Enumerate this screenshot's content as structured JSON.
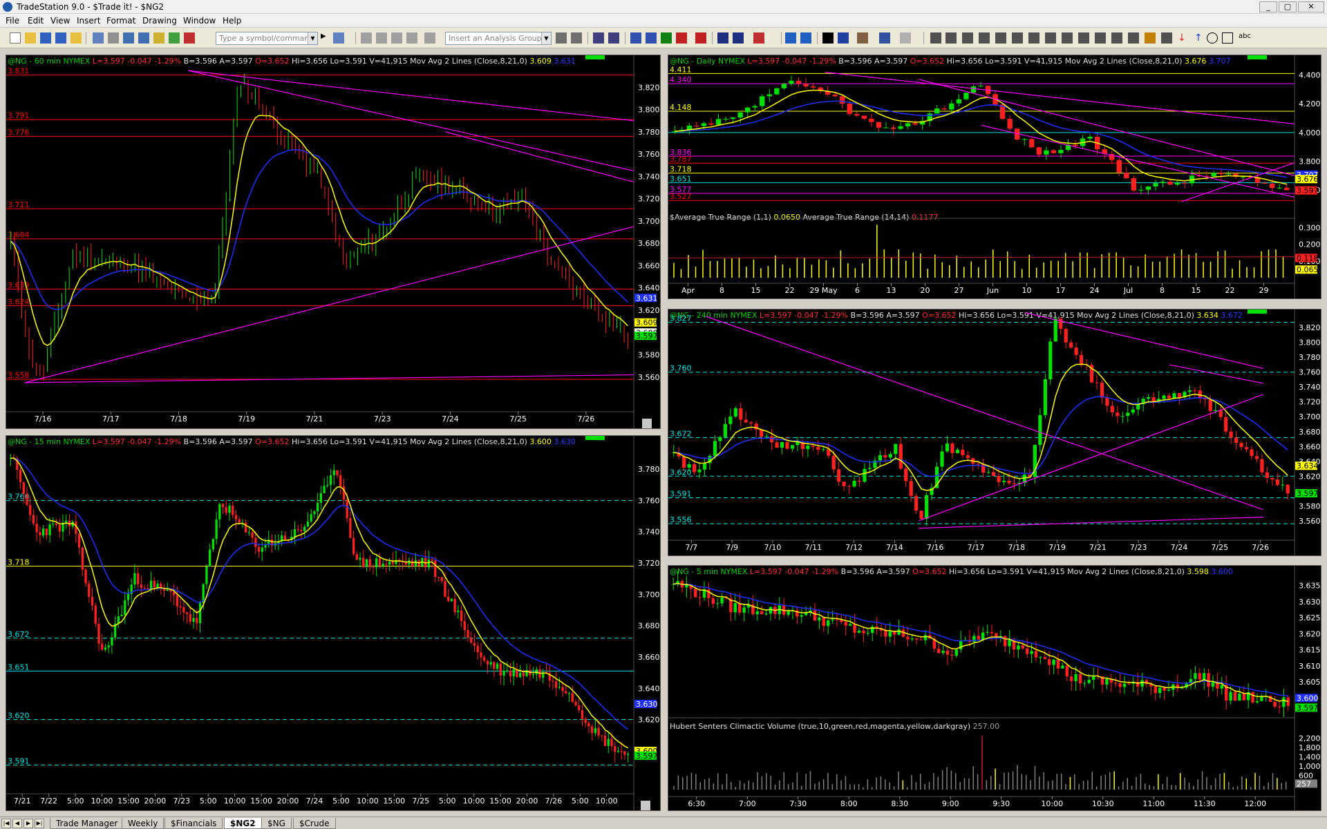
{
  "window": {
    "title": "TradeStation 9.0 - $Trade it! - $NG2"
  },
  "menu": [
    "File",
    "Edit",
    "View",
    "Insert",
    "Format",
    "Drawing",
    "Window",
    "Help"
  ],
  "toolbar": {
    "symbol_placeholder": "Type a symbol/command",
    "analysis_placeholder": "Insert an Analysis Group"
  },
  "colors": {
    "background": "#000000",
    "up_bar": "#00e000",
    "down_bar": "#ff2020",
    "avg_fast": "#ffff00",
    "avg_slow": "#2030ff",
    "trendline": "#ff00ff",
    "hline_red": "#ff0000",
    "hline_cyan": "#00e5e5",
    "hline_yellow": "#ffff00",
    "axis_text": "#ffffff"
  },
  "charts": {
    "c60": {
      "symbol": "@NG - 60 min NYMEX",
      "quote": {
        "L": "L=3.597",
        "chg": "-0.047",
        "pct": "-1.29%",
        "B": "B=3.596",
        "A": "A=3.597",
        "O": "O=3.652",
        "H": "Hi=3.656",
        "Lo": "Lo=3.591",
        "V": "V=41,915",
        "study": "Mov Avg 2 Lines (Close,8,21,0)",
        "v1": "3.609",
        "v2": "3.631"
      },
      "y_ticks": [
        "3.820",
        "3.800",
        "3.780",
        "3.760",
        "3.740",
        "3.720",
        "3.700",
        "3.680",
        "3.660",
        "3.640",
        "3.620",
        "3.580",
        "3.560"
      ],
      "x_ticks": [
        "7/16",
        "7/17",
        "7/18",
        "7/19",
        "7/21",
        "7/23",
        "7/24",
        "7/25",
        "7/26"
      ],
      "hlines": [
        "3.831",
        "3.791",
        "3.776",
        "3.711",
        "3.684",
        "3.639",
        "3.624",
        "3.558"
      ],
      "tags": [
        "3.631",
        "3.609",
        "3.600",
        "3.597"
      ]
    },
    "c15": {
      "symbol": "@NG - 15 min NYMEX",
      "quote": {
        "L": "L=3.597",
        "chg": "-0.047",
        "pct": "-1.29%",
        "B": "B=3.596",
        "A": "A=3.597",
        "O": "O=3.652",
        "H": "Hi=3.656",
        "Lo": "Lo=3.591",
        "V": "V=41,915",
        "study": "Mov Avg 2 Lines (Close,8,21,0)",
        "v1": "3.600",
        "v2": "3.630"
      },
      "y_ticks": [
        "3.780",
        "3.760",
        "3.740",
        "3.720",
        "3.700",
        "3.680",
        "3.660",
        "3.640",
        "3.620"
      ],
      "x_ticks": [
        "7/21",
        "7/22",
        "5:00",
        "10:00",
        "15:00",
        "20:00",
        "7/23",
        "5:00",
        "10:00",
        "15:00",
        "20:00",
        "7/24",
        "5:00",
        "10:00",
        "15:00",
        "7/25",
        "5:00",
        "10:00",
        "15:00",
        "20:00",
        "7/26",
        "5:00",
        "10:00"
      ],
      "hlines": [
        "3.760",
        "3.718",
        "3.672",
        "3.651",
        "3.620",
        "3.591"
      ],
      "tags": [
        "3.630",
        "3.600",
        "3.597"
      ]
    },
    "daily": {
      "symbol": "@NG - Daily NYMEX",
      "quote": {
        "L": "L=3.597",
        "chg": "-0.047",
        "pct": "-1.29%",
        "B": "B=3.596",
        "A": "A=3.597",
        "O": "O=3.652",
        "H": "Hi=3.656",
        "Lo": "Lo=3.591",
        "V": "V=41,915",
        "study": "Mov Avg 2 Lines (Close,8,21,0)",
        "v1": "3.676",
        "v2": "3.707"
      },
      "y_ticks": [
        "4.400",
        "4.200",
        "4.000",
        "3.800",
        "3.600"
      ],
      "hlines": [
        "4.411",
        "4.340",
        "4.148",
        "4.0",
        "3.836",
        "3.787",
        "3.718",
        "3.651",
        "3.577",
        "3.527"
      ],
      "tags": [
        "3.707",
        "3.676",
        "3.597"
      ],
      "atr_title": "$Average True Range (1,1)",
      "atr_v1": "0.0650",
      "atr2_title": "Average True Range (14,14)",
      "atr_v2": "0.1177",
      "atr_ticks": [
        "0.300",
        "0.200",
        "0.100"
      ],
      "atr_tags": [
        "0.118",
        "0.065"
      ],
      "x_ticks": [
        "Apr",
        "8",
        "15",
        "22",
        "29 May",
        "6",
        "13",
        "20",
        "27",
        "Jun",
        "10",
        "17",
        "24",
        "Jul",
        "8",
        "15",
        "22",
        "29"
      ]
    },
    "c240": {
      "symbol": "@NG - 240 min NYMEX",
      "quote": {
        "L": "L=3.597",
        "chg": "-0.047",
        "pct": "-1.29%",
        "B": "B=3.596",
        "A": "A=3.597",
        "O": "O=3.652",
        "H": "Hi=3.656",
        "Lo": "Lo=3.591",
        "V": "V=41,915",
        "study": "Mov Avg 2 Lines (Close,8,21,0)",
        "v1": "3.634",
        "v2": "3.672"
      },
      "y_ticks": [
        "3.820",
        "3.800",
        "3.780",
        "3.760",
        "3.740",
        "3.720",
        "3.700",
        "3.680",
        "3.660",
        "3.640",
        "3.620",
        "3.580",
        "3.560"
      ],
      "hlines": [
        "3.827",
        "3.760",
        "3.672",
        "3.620",
        "3.591",
        "3.556"
      ],
      "tags": [
        "3.634",
        "3.597"
      ],
      "x_ticks": [
        "7/7",
        "7/9",
        "7/10",
        "7/11",
        "7/12",
        "7/14",
        "7/16",
        "7/17",
        "7/18",
        "7/19",
        "7/21",
        "7/23",
        "7/24",
        "7/25",
        "7/26"
      ]
    },
    "c5": {
      "symbol": "@NG - 5 min NYMEX",
      "quote": {
        "L": "L=3.597",
        "chg": "-0.047",
        "pct": "-1.29%",
        "B": "B=3.596",
        "A": "A=3.597",
        "O": "O=3.652",
        "H": "Hi=3.656",
        "Lo": "Lo=3.591",
        "V": "V=41,915",
        "study": "Mov Avg 2 Lines (Close,8,21,0)",
        "v1": "3.598",
        "v2": "3.600"
      },
      "y_ticks": [
        "3.635",
        "3.630",
        "3.625",
        "3.620",
        "3.615",
        "3.610",
        "3.605"
      ],
      "tags": [
        "3.600",
        "3.597"
      ],
      "vol_title": "Hubert Senters Climactic Volume (true,10,green,red,magenta,yellow,darkgray)",
      "vol_value": "257.00",
      "vol_ticks": [
        "2,200",
        "1,800",
        "1,400",
        "1,000",
        "600"
      ],
      "vol_tag": "257",
      "x_ticks": [
        "6:30",
        "7:00",
        "7:30",
        "8:00",
        "8:30",
        "9:00",
        "9:30",
        "10:00",
        "10:30",
        "11:00",
        "11:30",
        "12:00"
      ]
    }
  },
  "tabs": [
    "Trade Manager",
    "Weekly",
    "$Financials",
    "$NG2",
    "$NG",
    "$Crude"
  ],
  "active_tab": "$NG2"
}
